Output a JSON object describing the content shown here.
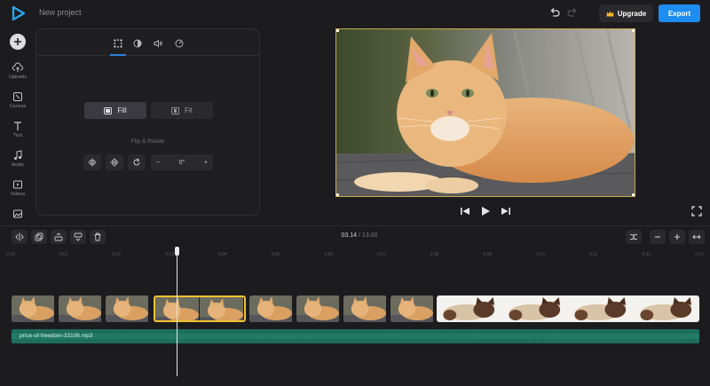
{
  "header": {
    "project_name": "New project",
    "upgrade_label": "Upgrade",
    "export_label": "Export"
  },
  "sidebar": {
    "items": [
      {
        "label": "Uploads",
        "icon": "upload-cloud-icon"
      },
      {
        "label": "Canvas",
        "icon": "canvas-icon"
      },
      {
        "label": "Text",
        "icon": "text-icon"
      },
      {
        "label": "Audio",
        "icon": "music-note-icon"
      },
      {
        "label": "Videos",
        "icon": "video-icon"
      },
      {
        "label": "",
        "icon": "image-icon"
      }
    ]
  },
  "panel": {
    "tabs": [
      "crop-icon",
      "contrast-icon",
      "volume-icon",
      "speed-icon"
    ],
    "fill_label": "Fill",
    "fit_label": "Fit",
    "section_label": "Flip & Rotate",
    "rotation_value": "0°",
    "minus_label": "−",
    "plus_label": "+"
  },
  "timeline": {
    "current_time": "03.14",
    "separator": "/",
    "total_time": "13.00",
    "ticks": [
      "0:00",
      "0:01",
      "0:02",
      "0:03",
      "0:04",
      "0:05",
      "0:06",
      "0:07",
      "0:08",
      "0:09",
      "0:10",
      "0:11",
      "0:12",
      "0:13"
    ],
    "audio_clip_name": "price-of-freedom-33106.mp3"
  },
  "colors": {
    "accent": "#1e8cf0",
    "selection": "#f2c230",
    "audio": "#1d6f5c"
  }
}
